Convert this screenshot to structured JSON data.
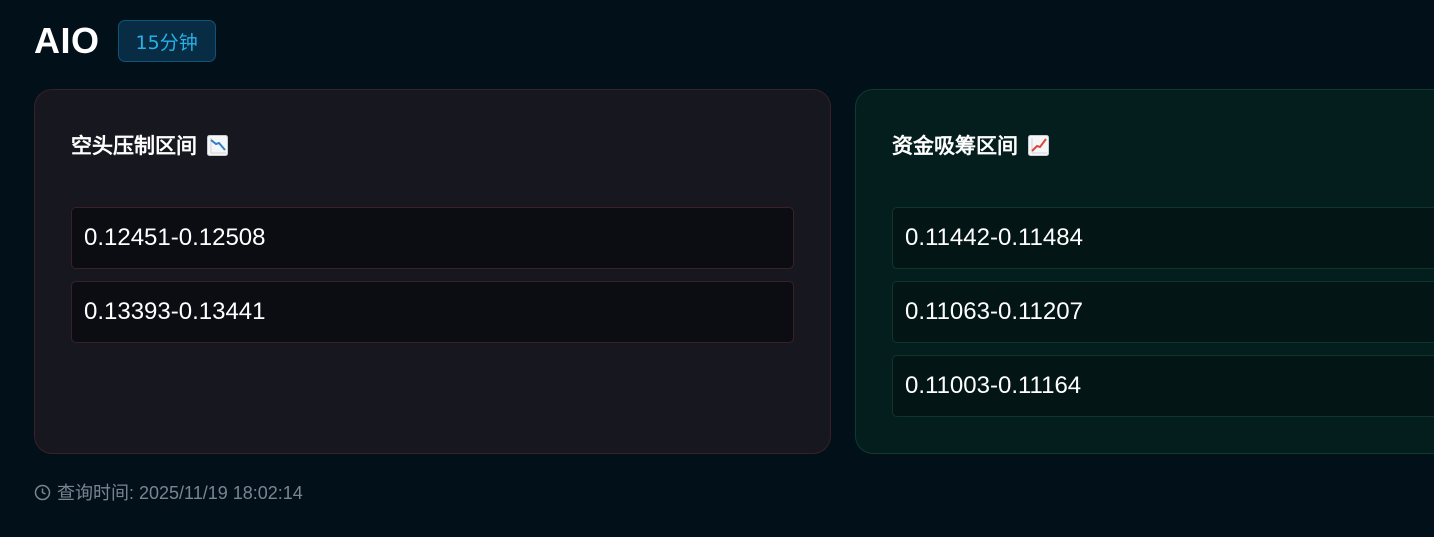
{
  "header": {
    "title": "AIO",
    "timeframe": "15分钟"
  },
  "bear_zone": {
    "title": "空头压制区间",
    "icon": "chart-decreasing-icon",
    "ranges": [
      "0.12451-0.12508",
      "0.13393-0.13441"
    ]
  },
  "bull_zone": {
    "title": "资金吸筹区间",
    "icon": "chart-increasing-icon",
    "ranges": [
      "0.11442-0.11484",
      "0.11063-0.11207",
      "0.11003-0.11164"
    ]
  },
  "footer": {
    "query_time_label": "查询时间: 2025/11/19 18:02:14",
    "icon": "clock-icon"
  },
  "colors": {
    "background": "#021019",
    "badge_text": "#27b0e8",
    "bear_card": "#17171f",
    "bull_card": "#041e1d"
  }
}
